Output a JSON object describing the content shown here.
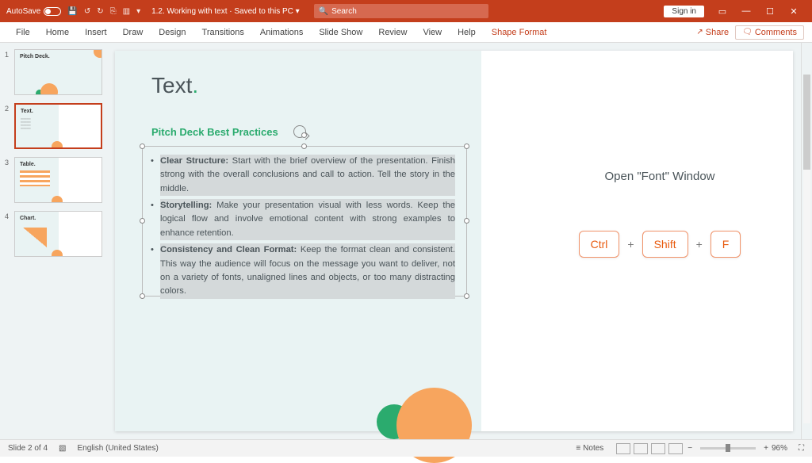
{
  "titlebar": {
    "autosave": "AutoSave",
    "doc_title": "1.2. Working with text · Saved to this PC ▾",
    "search_placeholder": "Search",
    "signin": "Sign in"
  },
  "ribbon": {
    "tabs": [
      "File",
      "Home",
      "Insert",
      "Draw",
      "Design",
      "Transitions",
      "Animations",
      "Slide Show",
      "Review",
      "View",
      "Help",
      "Shape Format"
    ],
    "share": "Share",
    "comments": "Comments"
  },
  "thumbs": {
    "labels": [
      "Pitch Deck.",
      "Text.",
      "Table.",
      "Chart."
    ]
  },
  "slide": {
    "title": "Text",
    "subtitle": "Pitch Deck Best Practices",
    "bullets": [
      {
        "b": "Clear Structure:",
        "t": " Start with the brief overview of the presentation. Finish strong with the overall conclusions and call to action. Tell the story in the middle."
      },
      {
        "b": "Storytelling:",
        "t": " Make your presentation visual with less words. Keep the logical flow and involve emotional content with strong examples to enhance retention."
      },
      {
        "b": "Consistency and Clean Format:",
        "t": " Keep the format clean and consistent. This way the audience will focus on the message you want to deliver, not on a variety of fonts, unaligned lines and objects, or too many distracting colors."
      }
    ]
  },
  "callout": {
    "label": "Open \"Font\" Window",
    "keys": [
      "Ctrl",
      "Shift",
      "F"
    ],
    "sep": "+"
  },
  "status": {
    "slide": "Slide 2 of 4",
    "lang": "English (United States)",
    "notes": "Notes",
    "zoom": "96%"
  }
}
